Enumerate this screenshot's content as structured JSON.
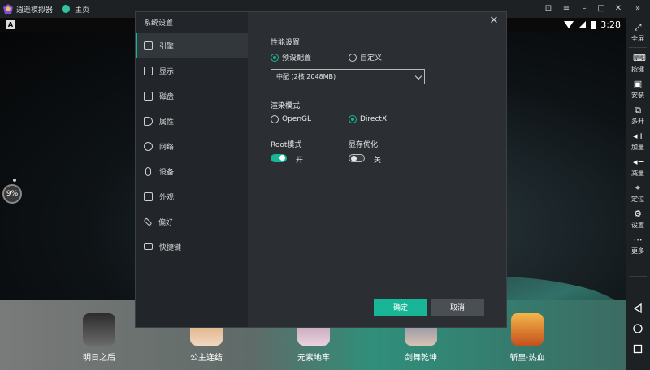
{
  "titlebar": {
    "app_title": "逍遥模拟器",
    "tab_home": "主页",
    "controls": [
      "pin-icon",
      "settings-icon",
      "minimize-icon",
      "maximize-icon",
      "close-icon",
      "collapse-icon"
    ]
  },
  "statusbar": {
    "time": "3:28",
    "left_badge": "A"
  },
  "perf_bubble": "9%",
  "dock": [
    {
      "label": "明日之后"
    },
    {
      "label": "公主连结"
    },
    {
      "label": "元素地牢"
    },
    {
      "label": "剑舞乾坤"
    },
    {
      "label": "斩皇·热血"
    }
  ],
  "toolbar": [
    {
      "icon": "fullscreen-icon",
      "label": "全屏"
    },
    {
      "icon": "keyboard-icon",
      "label": "按键"
    },
    {
      "icon": "apk-install-icon",
      "label": "安装"
    },
    {
      "icon": "multi-instance-icon",
      "label": "多开"
    },
    {
      "icon": "volume-up-icon",
      "label": "加量"
    },
    {
      "icon": "volume-down-icon",
      "label": "减量"
    },
    {
      "icon": "location-icon",
      "label": "定位"
    },
    {
      "icon": "gear-icon",
      "label": "设置"
    },
    {
      "icon": "more-icon",
      "label": "更多"
    }
  ],
  "dialog": {
    "title": "系统设置",
    "menu": [
      {
        "icon": "engine-icon",
        "label": "引擎",
        "active": true
      },
      {
        "icon": "display-icon",
        "label": "显示"
      },
      {
        "icon": "disk-icon",
        "label": "磁盘"
      },
      {
        "icon": "tag-icon",
        "label": "属性"
      },
      {
        "icon": "globe-icon",
        "label": "网络"
      },
      {
        "icon": "microphone-icon",
        "label": "设备"
      },
      {
        "icon": "appearance-icon",
        "label": "外观"
      },
      {
        "icon": "wrench-icon",
        "label": "偏好"
      },
      {
        "icon": "keyboard-icon",
        "label": "快捷键"
      }
    ],
    "performance": {
      "title": "性能设置",
      "preset": "预设配置",
      "custom": "自定义",
      "selected_value": "中配 (2核 2048MB)"
    },
    "render": {
      "title": "渲染模式",
      "opengl": "OpenGL",
      "directx": "DirectX"
    },
    "root": {
      "title": "Root模式",
      "state": "开"
    },
    "vram": {
      "title": "显存优化",
      "state": "关"
    },
    "ok_label": "确定",
    "cancel_label": "取消"
  }
}
